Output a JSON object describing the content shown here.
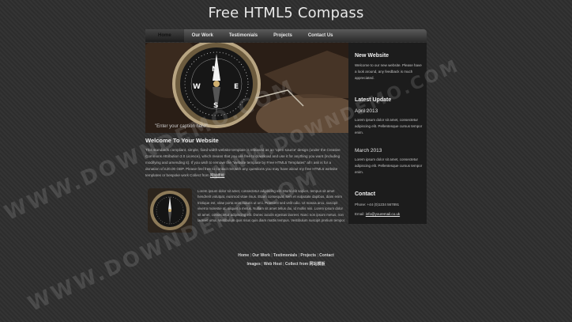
{
  "site": {
    "title": "Free HTML5 Compass"
  },
  "nav": {
    "items": [
      {
        "label": "Home"
      },
      {
        "label": "Our Work"
      },
      {
        "label": "Testimonials"
      },
      {
        "label": "Projects"
      },
      {
        "label": "Contact Us"
      }
    ]
  },
  "hero": {
    "caption": "\"Enter your caption here\""
  },
  "welcome": {
    "title": "Welcome To Your Website",
    "text": "This standards compliant, simple, fixed width website template is released as an 'open source' design (under the Creative Commons Attribution 3.0 Licence), which means that you are free to download and use it for anything you want (including modifying and amending it). If you wish to remove the \"website template by Free HTML5 Templates\" all I ask is for a donation of £20.00 GBP. Please feel free to contact me with any questions you may have about my free HTML5 website templates or bespoke work Collect from",
    "link": "网站模板"
  },
  "feature": {
    "text": "Lorem ipsum dolor sit amet, consectetur adipiscing elit. Morbi elit sapien, tempus sit amet hendrerit volutpat, euismod vitae risus. Etiam consequat, sem et vulputate dapibus, diam enim tristique est, vitae porta eros mauris ut orci. Praesent sed velit odio. Ut massa arcu, suscipit viverra molestie at, aliquet a metus. Nullam sit amet tellus dui, id mollis nisi. Lorem ipsum dolor sit amet, consectetur adipiscing elit. Donec iaculis egestas laoreet. Nunc non ipsum metus, non laoreet urna. Vestibulum quis risus quis diam mattis tempus. Vestibulum suscipit pretium tempor."
  },
  "sidebar": {
    "new_heading": "New Website",
    "new_text": "Welcome to our new website. Please have a look around, any feedback is much appreciated.",
    "latest_heading": "Latest Update",
    "date1": "April 2013",
    "text1": "Lorem ipsum dolor sit amet, consectetur adipiscing elit. Pellentesque cursus tempor enim.",
    "date2": "March 2013",
    "text2": "Lorem ipsum dolor sit amet, consectetur adipiscing elit. Pellentesque cursus tempor enim.",
    "contact_heading": "Contact",
    "phone": "Phone: +44 (0)1234 567891",
    "email_label": "Email:",
    "email": "info@youremail.co.uk"
  },
  "footer": {
    "links": [
      "Home",
      "Our Work",
      "Testimonials",
      "Projects",
      "Contact"
    ],
    "line2_links": [
      "Images",
      "Web Host"
    ],
    "collect": "Collect from",
    "collect_link": "网站模板"
  },
  "watermark": {
    "text": "WWW.DOWNDEMO.COM"
  }
}
